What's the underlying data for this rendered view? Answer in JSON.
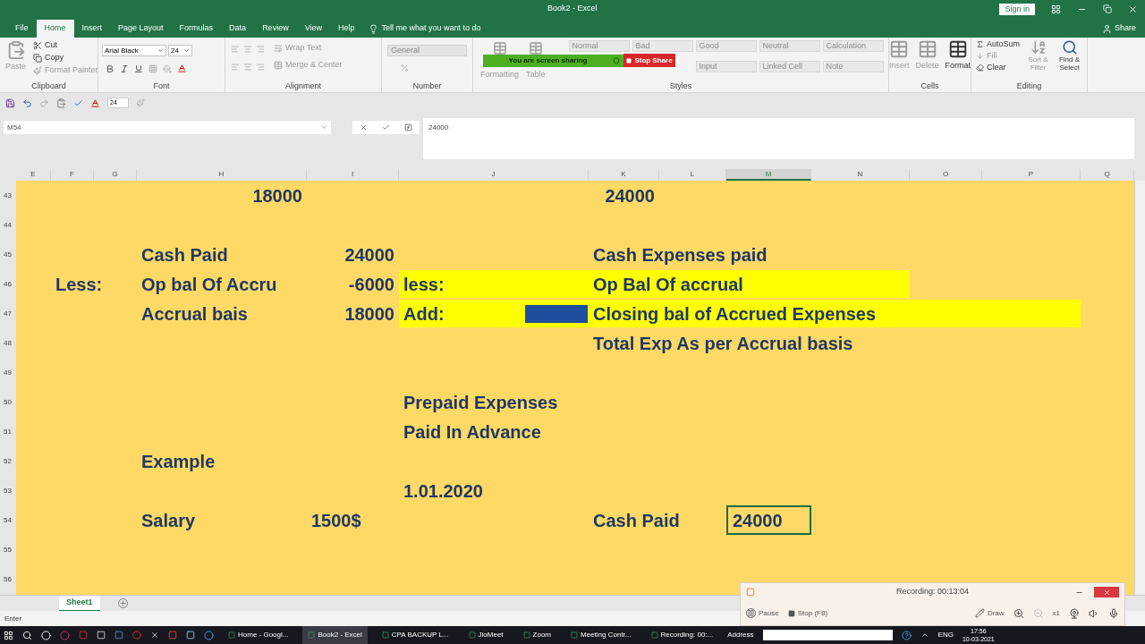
{
  "window": {
    "title": "Book2 - Excel",
    "sign_in": "Sign in"
  },
  "menu_tabs": [
    {
      "label": "File",
      "selected": false
    },
    {
      "label": "Home",
      "selected": true
    },
    {
      "label": "Insert",
      "selected": false
    },
    {
      "label": "Page Layout",
      "selected": false
    },
    {
      "label": "Formulas",
      "selected": false
    },
    {
      "label": "Data",
      "selected": false
    },
    {
      "label": "Review",
      "selected": false
    },
    {
      "label": "View",
      "selected": false
    },
    {
      "label": "Help",
      "selected": false
    }
  ],
  "tell_me": "Tell me what you want to do",
  "share": "Share",
  "ribbon": {
    "clipboard": {
      "label": "Clipboard",
      "paste": {
        "label": "Paste",
        "disabled": true
      },
      "cut": {
        "label": "Cut",
        "disabled": false
      },
      "copy": {
        "label": "Copy",
        "disabled": false
      },
      "format_painter": {
        "label": "Format Painter",
        "disabled": true
      }
    },
    "font": {
      "label": "Font",
      "family": "Arial Black",
      "size": "24"
    },
    "alignment": {
      "label": "Alignment",
      "wrap_text": {
        "label": "Wrap Text",
        "disabled": true
      },
      "merge": {
        "label": "Merge & Center",
        "disabled": true
      }
    },
    "number": {
      "label": "Number",
      "format": {
        "value": "General",
        "disabled": true
      }
    },
    "styles": {
      "label": "Styles",
      "conditional": {
        "label": "Formatting",
        "disabled": true
      },
      "format_table": {
        "label": "Table",
        "disabled": true
      },
      "cell_styles": [
        {
          "label": "Normal"
        },
        {
          "label": "Bad"
        },
        {
          "label": "Good"
        },
        {
          "label": "Neutral"
        },
        {
          "label": "Calculation"
        },
        {
          "label": "Input"
        },
        {
          "label": "Linked Cell"
        },
        {
          "label": "Note"
        }
      ]
    },
    "cells": {
      "label": "Cells",
      "buttons": [
        {
          "label": "Insert",
          "disabled": true
        },
        {
          "label": "Delete",
          "disabled": true
        },
        {
          "label": "Format",
          "disabled": false
        }
      ]
    },
    "editing": {
      "label": "Editing",
      "buttons": [
        {
          "label": "AutoSum",
          "disabled": false
        },
        {
          "label": "Fill",
          "disabled": true
        },
        {
          "label": "Clear",
          "disabled": false
        },
        {
          "label": "Sort & Filter",
          "disabled": true
        },
        {
          "label": "Find & Select",
          "disabled": false
        }
      ]
    }
  },
  "screen_share": {
    "message": "You are screen sharing",
    "stop": "Stop Share"
  },
  "quick_access": {
    "font_size": "24"
  },
  "formula_bar": {
    "name_box": "M54",
    "value": "24000"
  },
  "columns": [
    {
      "label": "E",
      "selected": false
    },
    {
      "label": "F",
      "selected": false
    },
    {
      "label": "G",
      "selected": false
    },
    {
      "label": "H",
      "selected": false
    },
    {
      "label": "I",
      "selected": false
    },
    {
      "label": "J",
      "selected": false
    },
    {
      "label": "K",
      "selected": false
    },
    {
      "label": "L",
      "selected": false
    },
    {
      "label": "M",
      "selected": true
    },
    {
      "label": "N",
      "selected": false
    },
    {
      "label": "O",
      "selected": false
    },
    {
      "label": "P",
      "selected": false
    },
    {
      "label": "Q",
      "selected": false
    }
  ],
  "rows": [
    {
      "number": "43",
      "cells": {
        "H": {
          "kind": "number",
          "text": "18000",
          "selected": false
        },
        "K": {
          "kind": "number",
          "text": "24000",
          "selected": false
        }
      }
    },
    {
      "number": "44",
      "cells": {}
    },
    {
      "number": "45",
      "cells": {
        "H": {
          "kind": "text",
          "text": "Cash Paid",
          "selected": false
        },
        "I": {
          "kind": "number",
          "text": "24000",
          "selected": false
        },
        "K": {
          "kind": "text",
          "text": "Cash Expenses paid",
          "selected": false
        }
      }
    },
    {
      "number": "46",
      "highlighted": {
        "J": true,
        "K": true,
        "L": true,
        "M": true,
        "N": true
      },
      "cells": {
        "F": {
          "kind": "text",
          "text": "Less:",
          "selected": false
        },
        "H": {
          "kind": "text",
          "text": "Op bal Of Accru",
          "selected": false
        },
        "I": {
          "kind": "number",
          "text": "-6000",
          "selected": false
        },
        "J": {
          "kind": "text",
          "text": "less:",
          "selected": false
        },
        "K": {
          "kind": "text",
          "text": "Op Bal Of accrual",
          "selected": false
        }
      }
    },
    {
      "number": "47",
      "highlighted": {
        "J": true,
        "K": true,
        "L": true,
        "M": true,
        "N": true,
        "O": true,
        "P": true
      },
      "marker_bar": true,
      "cells": {
        "H": {
          "kind": "text",
          "text": "Accrual bais",
          "selected": false
        },
        "I": {
          "kind": "number",
          "text": "18000",
          "selected": false
        },
        "J": {
          "kind": "text",
          "text": "Add:",
          "selected": false
        },
        "K": {
          "kind": "text",
          "text": "Closing bal of Accrued Expenses",
          "selected": false
        }
      }
    },
    {
      "number": "48",
      "cells": {
        "K": {
          "kind": "text",
          "text": "Total Exp As per Accrual basis",
          "selected": false
        }
      }
    },
    {
      "number": "49",
      "cells": {}
    },
    {
      "number": "50",
      "cells": {
        "J": {
          "kind": "text",
          "text": "Prepaid Expenses",
          "selected": false
        }
      }
    },
    {
      "number": "51",
      "cells": {
        "J": {
          "kind": "text",
          "text": "Paid In Advance",
          "selected": false
        }
      }
    },
    {
      "number": "52",
      "cells": {
        "H": {
          "kind": "text",
          "text": "Example",
          "selected": false
        }
      }
    },
    {
      "number": "53",
      "cells": {
        "J": {
          "kind": "text",
          "text": "1.01.2020",
          "selected": false
        }
      }
    },
    {
      "number": "54",
      "cells": {
        "H": {
          "kind": "text",
          "text": "Salary",
          "selected": false
        },
        "I": {
          "kind": "text",
          "text": "1500$",
          "selected": false
        },
        "K": {
          "kind": "text",
          "text": "Cash Paid",
          "selected": false
        },
        "M": {
          "kind": "text",
          "text": "24000",
          "selected": true
        }
      }
    },
    {
      "number": "55",
      "cells": {}
    },
    {
      "number": "56",
      "cells": {}
    }
  ],
  "sheet_tabs": [
    {
      "label": "Sheet1",
      "selected": true
    }
  ],
  "status_bar": "Enter",
  "recording": {
    "title": "Recording:",
    "time": "00:13:04",
    "pause": "Pause",
    "stop": "Stop",
    "stop_key": "(F8)",
    "draw": "Draw",
    "zoom": "x1"
  },
  "taskbar": {
    "apps": [
      {
        "label": "Home - Googl...",
        "selected": false
      },
      {
        "label": "Book2 - Excel",
        "selected": true
      },
      {
        "label": "CPA BACKUP L...",
        "selected": false
      },
      {
        "label": "JioMeet",
        "selected": false
      },
      {
        "label": "Zoom",
        "selected": false
      },
      {
        "label": "Meeting Contr...",
        "selected": false
      },
      {
        "label": "Recording: 00:...",
        "selected": false
      }
    ],
    "address": "Address",
    "language": "ENG",
    "time": "17:56",
    "date": "10-03-2021"
  }
}
